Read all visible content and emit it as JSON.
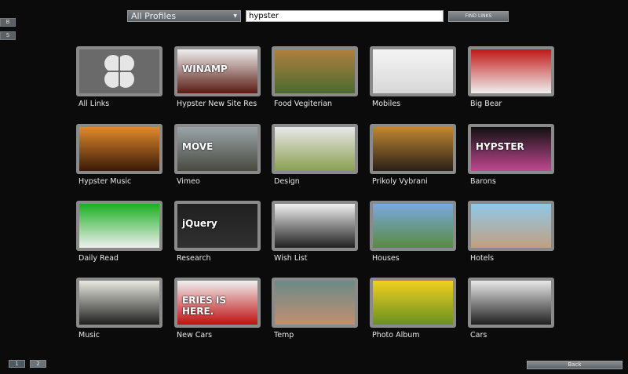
{
  "side_buttons": [
    "B",
    "S"
  ],
  "toolbar": {
    "profile_selected": "All Profiles",
    "search_value": "hypster",
    "find_label": "FIND LINKS"
  },
  "tiles": [
    {
      "label": "All Links",
      "icon": "clover-icon",
      "colors": [
        "#6a6a6a",
        "#6a6a6a"
      ]
    },
    {
      "label": "Hypster New Site Res",
      "colors": [
        "#f0f0f0",
        "#5a1a12"
      ],
      "text": "WINAMP"
    },
    {
      "label": "Food Vegiterian",
      "colors": [
        "#b08040",
        "#4a6a30"
      ]
    },
    {
      "label": "Mobiles",
      "colors": [
        "#f4f4f4",
        "#d8d8d8"
      ]
    },
    {
      "label": "Big Bear",
      "colors": [
        "#c01818",
        "#f0f0f0"
      ]
    },
    {
      "label": "Hypster Music",
      "colors": [
        "#e08a2a",
        "#3a1a08"
      ]
    },
    {
      "label": "Vimeo",
      "colors": [
        "#9aa4a8",
        "#4a4a40"
      ],
      "text": "MOVE"
    },
    {
      "label": "Design",
      "colors": [
        "#e8e8e8",
        "#8aa050"
      ]
    },
    {
      "label": "Prikoly Vybrani",
      "colors": [
        "#c08830",
        "#2a2018"
      ]
    },
    {
      "label": "Barons",
      "colors": [
        "#101010",
        "#c04890"
      ],
      "text": "HYPSTER"
    },
    {
      "label": "Daily Read",
      "colors": [
        "#1ab020",
        "#f0f0f0"
      ]
    },
    {
      "label": "Research",
      "colors": [
        "#202020",
        "#303030"
      ],
      "text": "jQuery"
    },
    {
      "label": "Wish List",
      "colors": [
        "#f0f0f0",
        "#202020"
      ]
    },
    {
      "label": "Houses",
      "colors": [
        "#7aa8e0",
        "#5a8a40"
      ]
    },
    {
      "label": "Hotels",
      "colors": [
        "#90c8e8",
        "#c0a080"
      ]
    },
    {
      "label": "Music",
      "colors": [
        "#e8e8e0",
        "#202020"
      ]
    },
    {
      "label": "New Cars",
      "colors": [
        "#f0f0f0",
        "#c01010"
      ],
      "text": "ERIES IS HERE."
    },
    {
      "label": "Temp",
      "colors": [
        "#6a8a88",
        "#c09070"
      ]
    },
    {
      "label": "Photo Album",
      "colors": [
        "#f0d020",
        "#6a9020"
      ]
    },
    {
      "label": "Cars",
      "colors": [
        "#e8e8e8",
        "#202020"
      ]
    }
  ],
  "pagination": [
    "1",
    "2"
  ],
  "back_label": "Back"
}
